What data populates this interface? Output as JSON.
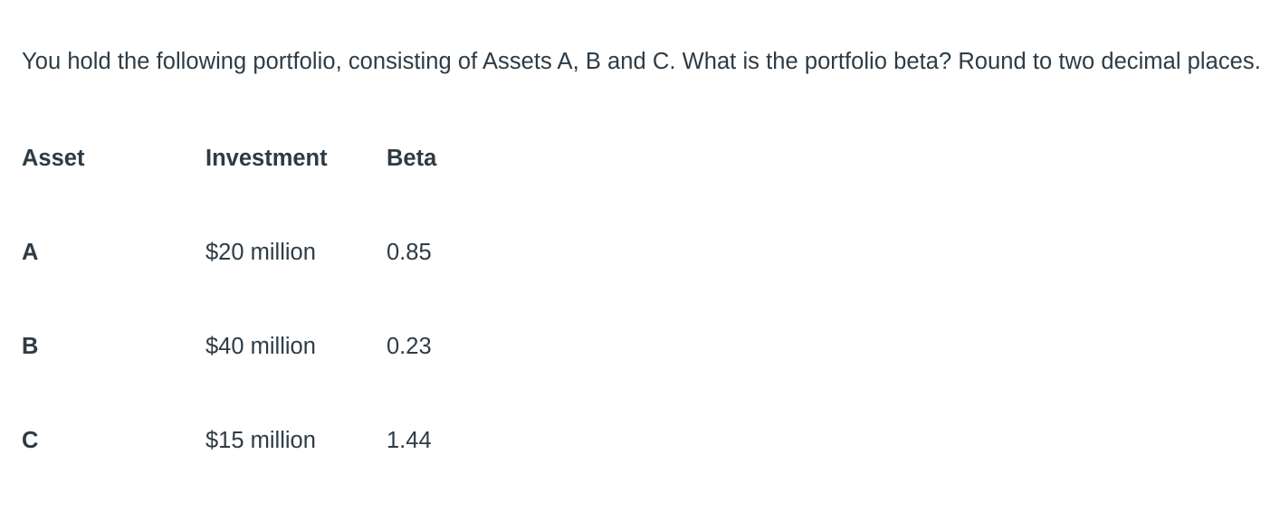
{
  "question": {
    "prompt": "You hold the following portfolio, consisting of Assets A, B and C. What is the portfolio beta? Round to two decimal places."
  },
  "table": {
    "headers": {
      "asset": "Asset",
      "investment": "Investment",
      "beta": "Beta"
    },
    "rows": [
      {
        "asset": "A",
        "investment": "$20 million",
        "beta": "0.85"
      },
      {
        "asset": "B",
        "investment": "$40 million",
        "beta": "0.23"
      },
      {
        "asset": "C",
        "investment": "$15 million",
        "beta": "1.44"
      }
    ]
  },
  "colors": {
    "text": "#2d3b45",
    "background": "#ffffff"
  }
}
